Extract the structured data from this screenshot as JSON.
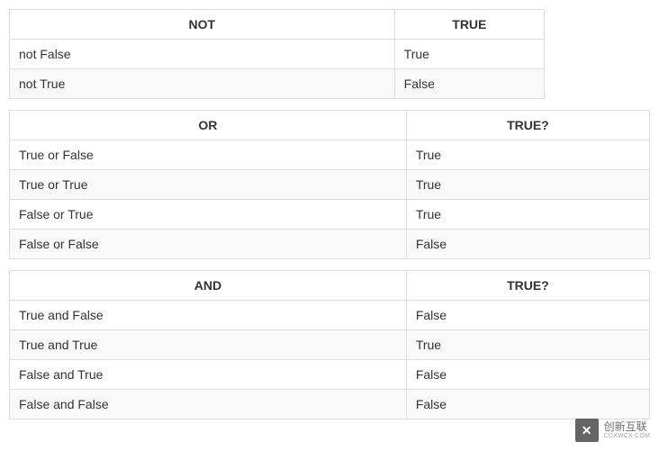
{
  "tables": [
    {
      "header1": "NOT",
      "header2": "TRUE",
      "rows": [
        {
          "c1": "not False",
          "c2": "True"
        },
        {
          "c1": "not True",
          "c2": "False"
        }
      ]
    },
    {
      "header1": "OR",
      "header2": "TRUE?",
      "rows": [
        {
          "c1": "True or False",
          "c2": "True"
        },
        {
          "c1": "True or True",
          "c2": "True"
        },
        {
          "c1": "False or True",
          "c2": "True"
        },
        {
          "c1": "False or False",
          "c2": "False"
        }
      ]
    },
    {
      "header1": "AND",
      "header2": "TRUE?",
      "rows": [
        {
          "c1": "True and False",
          "c2": "False"
        },
        {
          "c1": "True and True",
          "c2": "True"
        },
        {
          "c1": "False and True",
          "c2": "False"
        },
        {
          "c1": "False and False",
          "c2": "False"
        }
      ]
    }
  ],
  "watermark": {
    "logo": "✕",
    "cn": "创新互联",
    "en": "CDXWCX.COM"
  }
}
